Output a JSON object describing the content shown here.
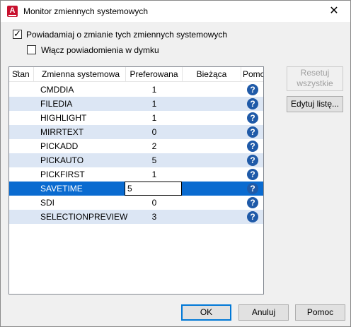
{
  "window": {
    "title": "Monitor zmiennych systemowych",
    "close_glyph": "✕",
    "app_icon_letter": "A"
  },
  "options": {
    "notify_label": "Powiadamiaj o zmianie tych zmiennych systemowych",
    "notify_checked": true,
    "balloon_label": "Włącz powiadomienia w dymku",
    "balloon_checked": false,
    "check_glyph": "✓"
  },
  "table": {
    "columns": [
      "Stan",
      "Zmienna systemowa",
      "Preferowana",
      "Bieżąca",
      "Pomoc"
    ],
    "sort_glyph": "▲",
    "help_glyph": "?",
    "rows": [
      {
        "name": "CMDDIA",
        "preferred": "1",
        "current": ""
      },
      {
        "name": "FILEDIA",
        "preferred": "1",
        "current": ""
      },
      {
        "name": "HIGHLIGHT",
        "preferred": "1",
        "current": ""
      },
      {
        "name": "MIRRTEXT",
        "preferred": "0",
        "current": ""
      },
      {
        "name": "PICKADD",
        "preferred": "2",
        "current": ""
      },
      {
        "name": "PICKAUTO",
        "preferred": "5",
        "current": ""
      },
      {
        "name": "PICKFIRST",
        "preferred": "1",
        "current": ""
      },
      {
        "name": "SAVETIME",
        "preferred": "5",
        "current": "",
        "selected": true,
        "editing": true
      },
      {
        "name": "SDI",
        "preferred": "0",
        "current": ""
      },
      {
        "name": "SELECTIONPREVIEW",
        "preferred": "3",
        "current": ""
      }
    ]
  },
  "side_buttons": {
    "reset_line1": "Resetuj",
    "reset_line2": "wszystkie",
    "edit_list": "Edytuj listę..."
  },
  "footer": {
    "ok": "OK",
    "cancel": "Anuluj",
    "help": "Pomoc"
  },
  "colors": {
    "selection": "#0a6bd0",
    "alt_row": "#dce6f4",
    "help_icon": "#1f5aa8",
    "app_icon": "#c8102e"
  }
}
